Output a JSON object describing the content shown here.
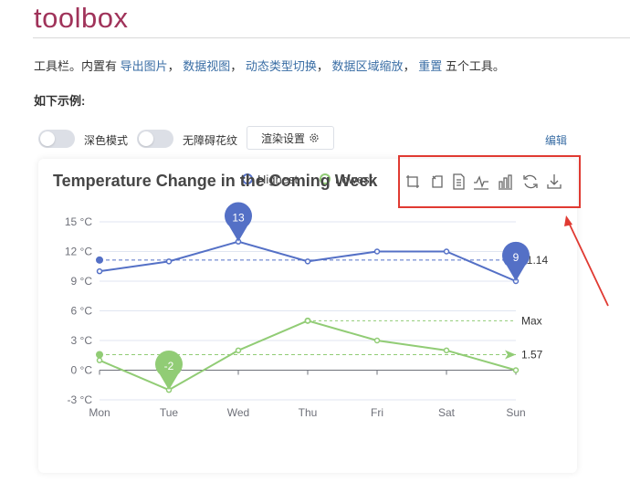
{
  "page": {
    "title": "toolbox",
    "desc": {
      "prefix": "工具栏。内置有 ",
      "link1": "导出图片",
      "sep1": "， ",
      "link2": "数据视图",
      "sep2": "， ",
      "link3": "动态类型切换",
      "sep3": "， ",
      "link4": "数据区域缩放",
      "sep4": "， ",
      "link5": "重置",
      "suffix": " 五个工具。"
    },
    "example_label": "如下示例:"
  },
  "controls": {
    "dark_mode_label": "深色模式",
    "aria_label": "无障碍花纹",
    "render_button": "渲染设置",
    "edit_link": "编辑"
  },
  "colors": {
    "highest": "#5470c6",
    "lowest": "#91cc75",
    "annotation_box": "#e03a32"
  },
  "toolbox_icons": [
    "zoom-icon",
    "zoom-reset-icon",
    "data-view-icon",
    "line-type-icon",
    "bar-type-icon",
    "restore-icon",
    "save-image-icon"
  ],
  "chart_data": {
    "type": "line",
    "title": "Temperature Change in the Coming Week",
    "categories": [
      "Mon",
      "Tue",
      "Wed",
      "Thu",
      "Fri",
      "Sat",
      "Sun"
    ],
    "series": [
      {
        "name": "Highest",
        "values": [
          10,
          11,
          13,
          11,
          12,
          12,
          9
        ],
        "max_pin": "13",
        "min_pin": "9",
        "avg_label": "11.14",
        "avg": 11.14
      },
      {
        "name": "Lowest",
        "values": [
          1,
          -2,
          2,
          5,
          3,
          2,
          0
        ],
        "min_pin": "-2",
        "max_label": "Max",
        "avg_label": "1.57",
        "avg": 1.57
      }
    ],
    "y_ticks": [
      "15 °C",
      "12 °C",
      "9 °C",
      "6 °C",
      "3 °C",
      "0 °C",
      "-3 °C"
    ],
    "y_tick_values": [
      15,
      12,
      9,
      6,
      3,
      0,
      -3
    ],
    "ylim": [
      -3,
      15
    ],
    "y_unit": "°C",
    "legend_position": "top-center",
    "grid": true
  }
}
